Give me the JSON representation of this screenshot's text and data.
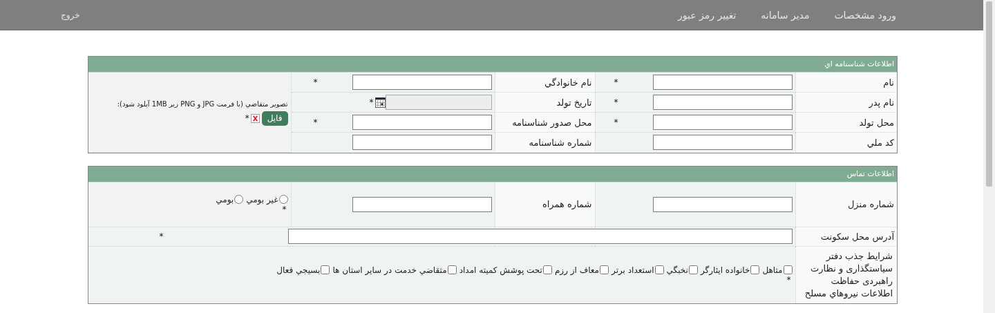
{
  "nav": {
    "items": [
      {
        "label": "ورود مشخصات"
      },
      {
        "label": "مدیر سامانه"
      },
      {
        "label": "تغییر رمز عبور"
      }
    ],
    "logout": "خروج"
  },
  "identity": {
    "title": "اطلاعات شناسنامه اي",
    "fields": [
      {
        "label": "نام",
        "kind": "text",
        "mark": "*"
      },
      {
        "label": "نام خانوادگي",
        "kind": "text",
        "mark": "*"
      },
      {
        "label": "نام پدر",
        "kind": "text",
        "mark": "*"
      },
      {
        "label": "تاریخ تولد",
        "kind": "date",
        "mark": "*"
      },
      {
        "label": "محل تولد",
        "kind": "text",
        "mark": "*"
      },
      {
        "label": "محل صدور شناسنامه",
        "kind": "text",
        "mark": "*"
      },
      {
        "label": "کد ملي",
        "kind": "text"
      },
      {
        "label": "شماره شناسنامه",
        "kind": "text"
      }
    ],
    "photo": {
      "caption": "تصویر متقاضي (با فرمت JPG و PNG زیر 1MB آپلود شود):",
      "button": "فایل",
      "mark": "*"
    }
  },
  "contact": {
    "title": "اطلاعات تماس",
    "home_phone": {
      "label": "شماره منزل"
    },
    "mobile": {
      "label": "شماره همراه"
    },
    "residency": {
      "options": [
        {
          "label": "غیر بومي",
          "selected": false
        },
        {
          "label": "بومي",
          "selected": false
        }
      ],
      "mark": "*"
    },
    "address": {
      "label": "آدرس محل سکونت",
      "mark": "*"
    },
    "conditions": {
      "label": "شرایط جذب دفتر سیاستگذاری و نظارت راهبردی حفاظت اطلاعات نیروهاي مسلح",
      "options": [
        {
          "label": "متاهل",
          "checked": false
        },
        {
          "label": "خانواده ایثارگر",
          "checked": false
        },
        {
          "label": "نخبگي",
          "checked": false
        },
        {
          "label": "استعداد برتر",
          "checked": false
        },
        {
          "label": "معاف از رزم",
          "checked": false
        },
        {
          "label": "تحت پوشش کمیته امداد",
          "checked": false
        },
        {
          "label": "متقاضي خدمت در سایر استان ها",
          "checked": false
        },
        {
          "label": "بسیجي فعال",
          "checked": false
        }
      ],
      "mark": "*"
    }
  }
}
